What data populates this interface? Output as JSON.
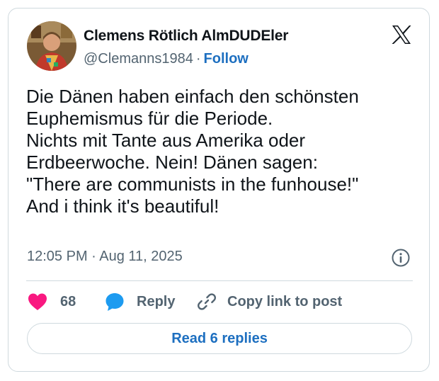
{
  "author": {
    "display_name": "Clemens Rötlich AlmDUDEler",
    "handle": "@Clemanns1984",
    "separator": "·",
    "follow_label": "Follow"
  },
  "tweet": {
    "text": "Die Dänen haben einfach den schönsten\nEuphemismus für die Periode.\nNichts mit Tante aus Amerika oder\nErdbeerwoche. Nein! Dänen sagen:\n\"There are communists in the funhouse!\"\nAnd i think it's beautiful!",
    "timestamp": "12:05 PM · Aug 11, 2025"
  },
  "actions": {
    "like_count": "68",
    "reply_label": "Reply",
    "copy_label": "Copy link to post"
  },
  "footer": {
    "read_replies_label": "Read 6 replies"
  },
  "icons": {
    "brand": "x-logo-icon",
    "info": "info-icon",
    "like": "heart-icon",
    "reply": "speech-bubble-icon",
    "copy": "link-icon"
  },
  "colors": {
    "accent": "#1d6fc0",
    "heart": "#f91880",
    "reply_bubble": "#1d9bf0",
    "muted": "#536471",
    "border": "#cfd9de"
  }
}
